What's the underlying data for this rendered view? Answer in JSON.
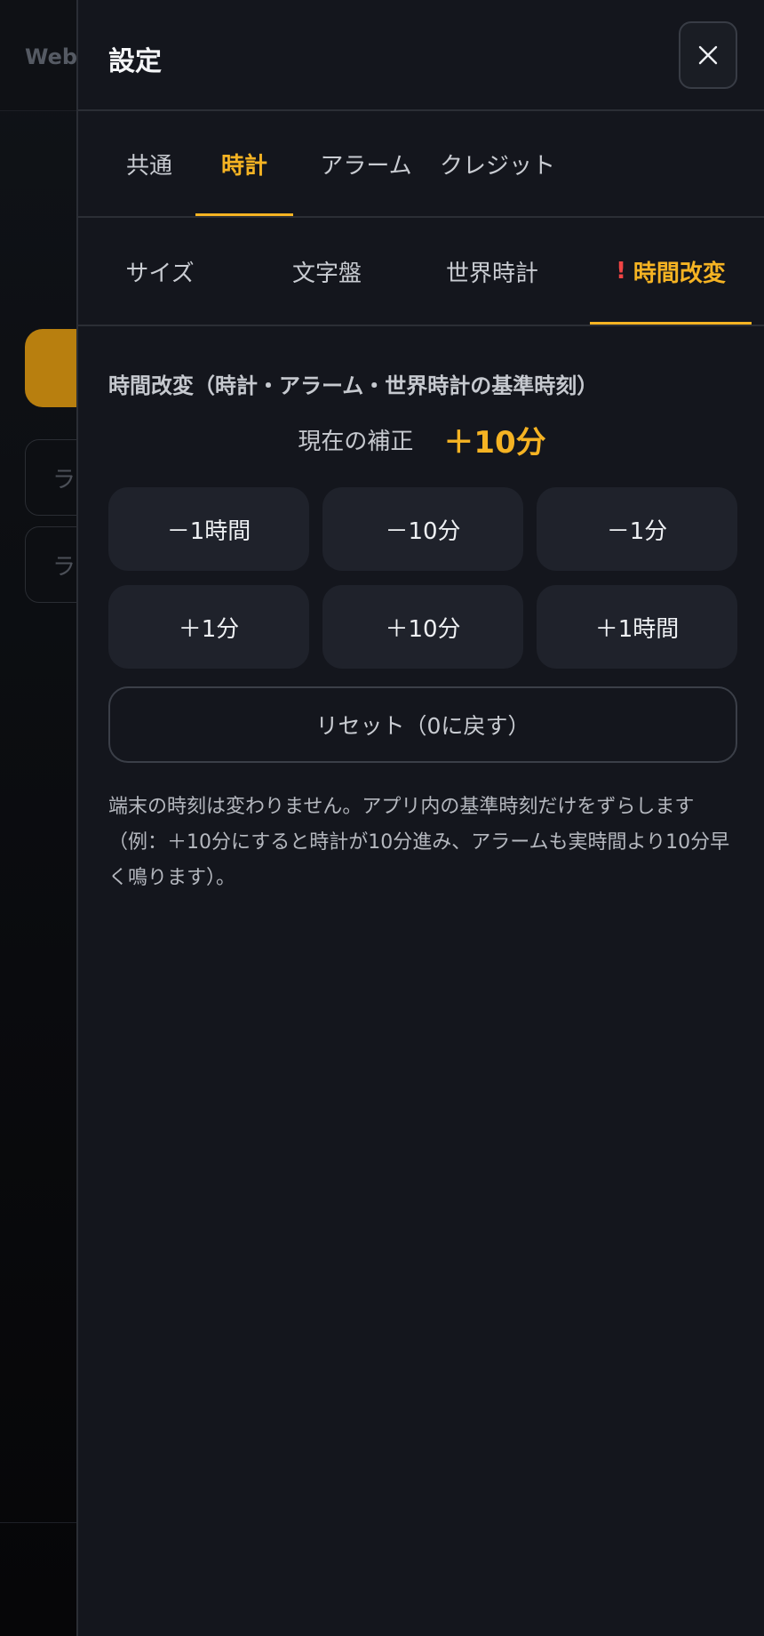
{
  "background": {
    "app_title": "Web",
    "field1_text": "ラ",
    "field2_text": "ラ"
  },
  "settings": {
    "title": "設定",
    "close_icon": "close-icon",
    "main_tabs": [
      {
        "label": "共通",
        "active": false
      },
      {
        "label": "時計",
        "active": true
      },
      {
        "label": "アラーム",
        "active": false
      },
      {
        "label": "クレジット",
        "active": false
      }
    ],
    "sub_tabs": [
      {
        "label": "サイズ",
        "active": false
      },
      {
        "label": "文字盤",
        "active": false
      },
      {
        "label": "世界時計",
        "active": false
      },
      {
        "label": "時間改変",
        "active": true,
        "warning": "!"
      }
    ],
    "section_heading": "時間改変（時計・アラーム・世界時計の基準時刻）",
    "offset_label": "現在の補正",
    "offset_value": "＋10分",
    "adjust_buttons": [
      "－1時間",
      "－10分",
      "－1分",
      "＋1分",
      "＋10分",
      "＋1時間"
    ],
    "reset_label": "リセット（0に戻す）",
    "note": "端末の時刻は変わりません。アプリ内の基準時刻だけをずらします（例：＋10分にすると時計が10分進み、アラームも実時間より10分早く鳴ります）。"
  },
  "colors": {
    "accent": "#f5b323",
    "warning": "#ef4444",
    "panel": "#14161d"
  }
}
